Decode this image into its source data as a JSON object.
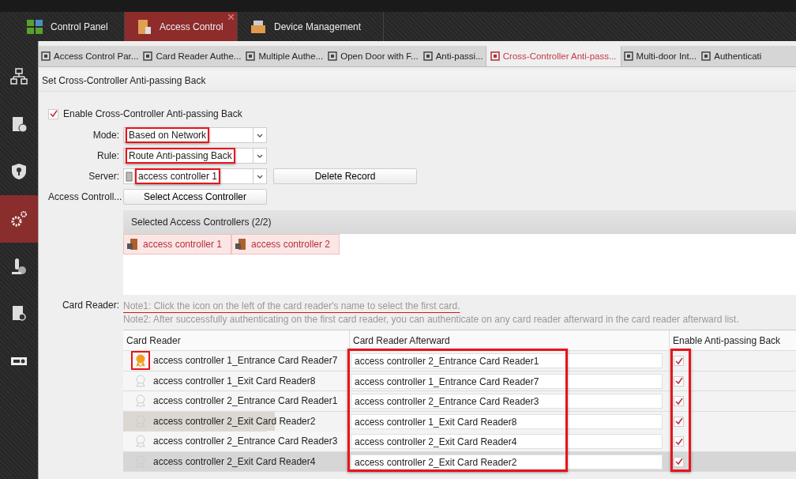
{
  "top_tabs": [
    {
      "label": "Control Panel",
      "selected": false
    },
    {
      "label": "Access Control",
      "selected": true
    },
    {
      "label": "Device Management",
      "selected": false
    }
  ],
  "sidebar": {
    "items": [
      {
        "selected": false
      },
      {
        "selected": false
      },
      {
        "selected": false
      },
      {
        "selected": true
      },
      {
        "selected": false
      },
      {
        "selected": false
      },
      {
        "selected": false
      }
    ]
  },
  "sub_tabs": [
    {
      "label": "Access Control Par...",
      "selected": false
    },
    {
      "label": "Card Reader Authe...",
      "selected": false
    },
    {
      "label": "Multiple Authe...",
      "selected": false
    },
    {
      "label": "Open Door with F...",
      "selected": false
    },
    {
      "label": "Anti-passi...",
      "selected": false
    },
    {
      "label": "Cross-Controller Anti-pass...",
      "selected": true
    },
    {
      "label": "Multi-door Int...",
      "selected": false
    },
    {
      "label": "Authenticati",
      "selected": false
    }
  ],
  "section_title": "Set Cross-Controller Anti-passing Back",
  "enable": {
    "label": "Enable Cross-Controller Anti-passing Back",
    "checked": true
  },
  "form": [
    {
      "label": "Mode:",
      "value": "Based on Network",
      "highlighted": true,
      "device_icon": false
    },
    {
      "label": "Rule:",
      "value": "Route Anti-passing Back",
      "highlighted": true,
      "device_icon": false
    },
    {
      "label": "Server:",
      "value": "access controller 1",
      "highlighted": true,
      "device_icon": true
    }
  ],
  "delete_button": "Delete Record",
  "access_controller": {
    "label": "Access Controll...",
    "button": "Select Access Controller"
  },
  "selected_panel": {
    "title": "Selected Access Controllers (2/2)",
    "items": [
      "access controller 1",
      "access controller 2"
    ]
  },
  "card_reader": {
    "label": "Card Reader:",
    "notes": [
      {
        "text": "Note1: Click the icon on the left of the card reader's name to select the first card.",
        "underlined": true
      },
      {
        "text": "Note2: After successfully authenticating on the first card reader, you can authenticate on any card reader afterward in the card reader afterward list.",
        "underlined": false
      }
    ]
  },
  "table": {
    "columns": [
      {
        "label": "Card Reader",
        "highlighted": false
      },
      {
        "label": "Card Reader Afterward",
        "highlighted": true
      },
      {
        "label": "Enable Anti-passing Back",
        "highlighted": true
      }
    ],
    "rows": [
      {
        "first": true,
        "highlighted": true,
        "card_reader": "access controller 1_Entrance Card Reader7",
        "afterward": "access controller 2_Entrance Card Reader1",
        "enabled": true,
        "selected": false,
        "hovered": false
      },
      {
        "first": false,
        "highlighted": false,
        "card_reader": "access controller 1_Exit Card Reader8",
        "afterward": "access controller 1_Entrance Card Reader7",
        "enabled": true,
        "selected": false,
        "hovered": false
      },
      {
        "first": false,
        "highlighted": false,
        "card_reader": "access controller 2_Entrance Card Reader1",
        "afterward": "access controller 2_Entrance Card Reader3",
        "enabled": true,
        "selected": false,
        "hovered": false
      },
      {
        "first": false,
        "highlighted": false,
        "card_reader": "access controller 2_Exit Card Reader2",
        "afterward": "access controller 1_Exit Card Reader8",
        "enabled": true,
        "selected": true,
        "hovered": false
      },
      {
        "first": false,
        "highlighted": false,
        "card_reader": "access controller 2_Entrance Card Reader3",
        "afterward": "access controller 2_Exit Card Reader4",
        "enabled": true,
        "selected": false,
        "hovered": false
      },
      {
        "first": false,
        "highlighted": false,
        "card_reader": "access controller 2_Exit Card Reader4",
        "afterward": "access controller 2_Exit Card Reader2",
        "enabled": true,
        "selected": false,
        "hovered": true
      }
    ]
  }
}
